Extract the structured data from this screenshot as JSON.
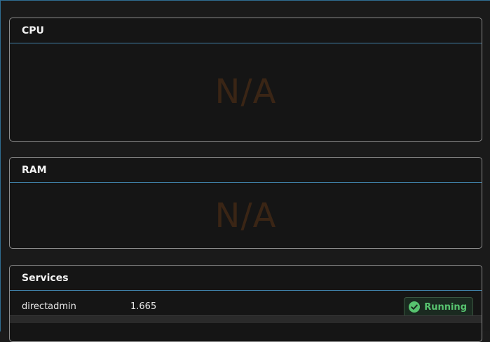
{
  "cpu": {
    "title": "CPU",
    "value": "N/A"
  },
  "ram": {
    "title": "RAM",
    "value": "N/A"
  },
  "services": {
    "title": "Services",
    "rows": [
      {
        "name": "directadmin",
        "version": "1.665",
        "status": "Running",
        "status_icon": "check-circle-icon",
        "status_color": "#57c36f"
      }
    ]
  }
}
